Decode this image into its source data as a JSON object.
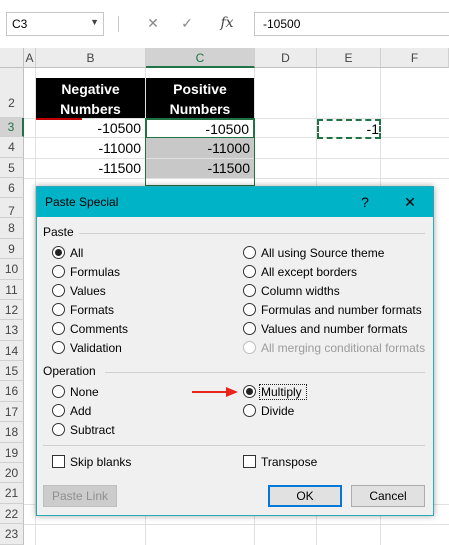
{
  "formula_bar": {
    "name_box": "C3",
    "cancel_icon": "✕",
    "enter_icon": "✓",
    "fx_label": "fx",
    "value": "-10500"
  },
  "sheet": {
    "columns": [
      "A",
      "B",
      "C",
      "D",
      "E",
      "F"
    ],
    "selected_column": "C",
    "rows": [
      "2",
      "3",
      "4",
      "5",
      "6",
      "7",
      "8",
      "9",
      "10",
      "11",
      "12",
      "13",
      "14",
      "15",
      "16",
      "17",
      "18",
      "19",
      "20",
      "21",
      "22",
      "23"
    ],
    "header_b": "Negative Numbers",
    "header_c": "Positive Numbers",
    "b_values": [
      "-10500",
      "-11000",
      "-11500"
    ],
    "c_values": [
      "-10500",
      "-11000",
      "-11500"
    ],
    "e3_value": "-1"
  },
  "dialog": {
    "title": "Paste Special",
    "help": "?",
    "close": "✕",
    "paste_section": "Paste",
    "paste_left": [
      "All",
      "Formulas",
      "Values",
      "Formats",
      "Comments",
      "Validation"
    ],
    "paste_right": [
      "All using Source theme",
      "All except borders",
      "Column widths",
      "Formulas and number formats",
      "Values and number formats",
      "All merging conditional formats"
    ],
    "operation_section": "Operation",
    "operation_left": [
      "None",
      "Add",
      "Subtract"
    ],
    "operation_right": [
      "Multiply",
      "Divide"
    ],
    "skip_blanks": "Skip blanks",
    "transpose": "Transpose",
    "paste_link": "Paste Link",
    "ok": "OK",
    "cancel": "Cancel"
  },
  "colors": {
    "accent": "#217346",
    "title_bar": "#00b3c7",
    "arrow": "#e8231a"
  }
}
